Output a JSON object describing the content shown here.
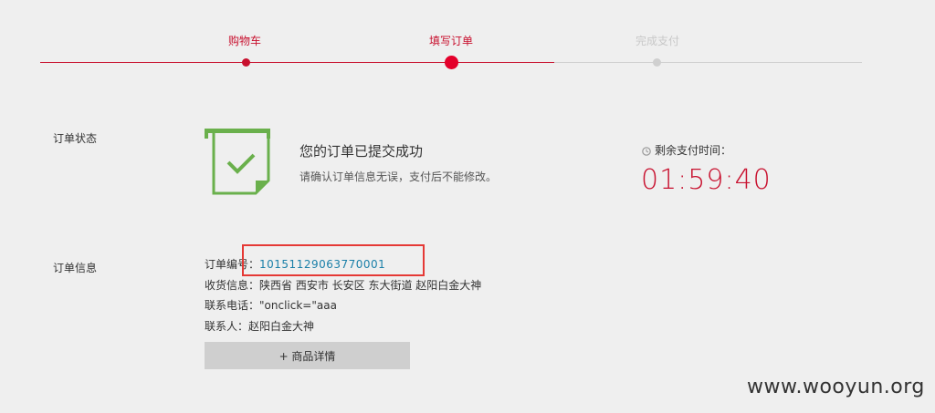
{
  "steps": [
    {
      "label": "购物车",
      "state": "done"
    },
    {
      "label": "填写订单",
      "state": "current"
    },
    {
      "label": "完成支付",
      "state": "todo"
    }
  ],
  "order_status": {
    "section_label": "订单状态",
    "title": "您的订单已提交成功",
    "description": "请确认订单信息无误，支付后不能修改。",
    "icon": "order-success-icon"
  },
  "timer": {
    "label": "剩余支付时间：",
    "value": "01:59:40",
    "icon": "clock-icon"
  },
  "order_info": {
    "section_label": "订单信息",
    "number_label": "订单编号：",
    "number_value": "10151129063770001",
    "address_label": "收货信息：",
    "address_value": "陕西省 西安市 长安区 东大街道 赵阳白金大神",
    "phone_label": "联系电话：",
    "phone_value": "\"onclick=\"aaa",
    "contact_label": "联系人：",
    "contact_value": "赵阳白金大神",
    "detail_button": "+ 商品详情"
  },
  "watermark": "www.wooyun.org",
  "colors": {
    "accent": "#c8102e",
    "link": "#1a7fa8",
    "success_green": "#6ab04c",
    "highlight": "#e53935"
  }
}
